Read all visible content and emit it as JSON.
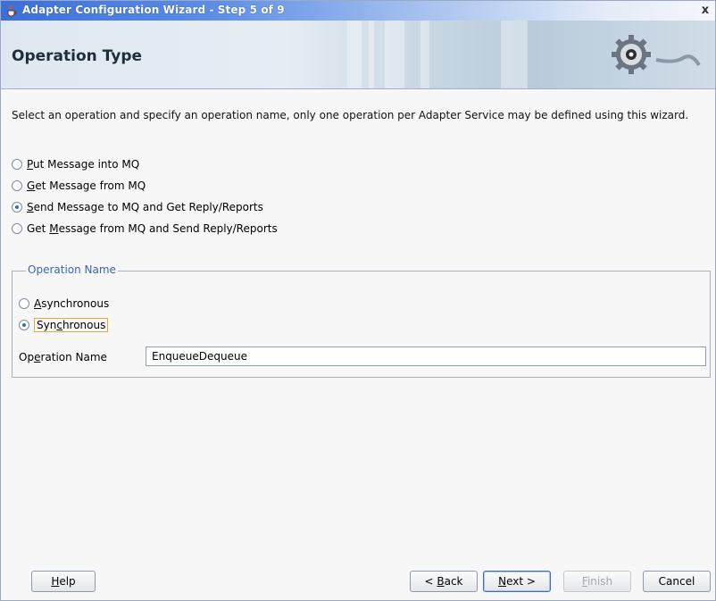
{
  "window": {
    "title": "Adapter Configuration Wizard - Step 5 of 9",
    "close_glyph": "x"
  },
  "header": {
    "heading": "Operation Type"
  },
  "description": "Select an operation and specify an operation name, only one operation per Adapter Service may be defined using this wizard.",
  "operation_types": [
    {
      "label_pre": "",
      "label_mnemonic": "P",
      "label_post": "ut Message into MQ",
      "checked": false
    },
    {
      "label_pre": "",
      "label_mnemonic": "G",
      "label_post": "et Message from MQ",
      "checked": false
    },
    {
      "label_pre": "",
      "label_mnemonic": "S",
      "label_post": "end Message to MQ and Get Reply/Reports",
      "checked": true
    },
    {
      "label_pre": "Get ",
      "label_mnemonic": "M",
      "label_post": "essage from MQ and Send Reply/Reports",
      "checked": false
    }
  ],
  "operation_name_group": {
    "title": "Operation Name",
    "modes": [
      {
        "label_pre": "",
        "label_mnemonic": "A",
        "label_post": "synchronous",
        "checked": false
      },
      {
        "label_pre": "Syn",
        "label_mnemonic": "c",
        "label_post": "hronous",
        "checked": true
      }
    ],
    "field_label_pre": "Op",
    "field_label_mnemonic": "e",
    "field_label_post": "ration Name",
    "field_value": "EnqueueDequeue"
  },
  "buttons": {
    "help_pre": "",
    "help_mnemonic": "H",
    "help_post": "elp",
    "back_pre": "< ",
    "back_mnemonic": "B",
    "back_post": "ack",
    "next_pre": "",
    "next_mnemonic": "N",
    "next_post": "ext >",
    "finish_pre": "",
    "finish_mnemonic": "F",
    "finish_post": "inish",
    "cancel": "Cancel"
  },
  "colors": {
    "titlebar_start": "#3a6fd8",
    "group_title": "#3a63b6",
    "radio_dot": "#2f6bd0"
  }
}
